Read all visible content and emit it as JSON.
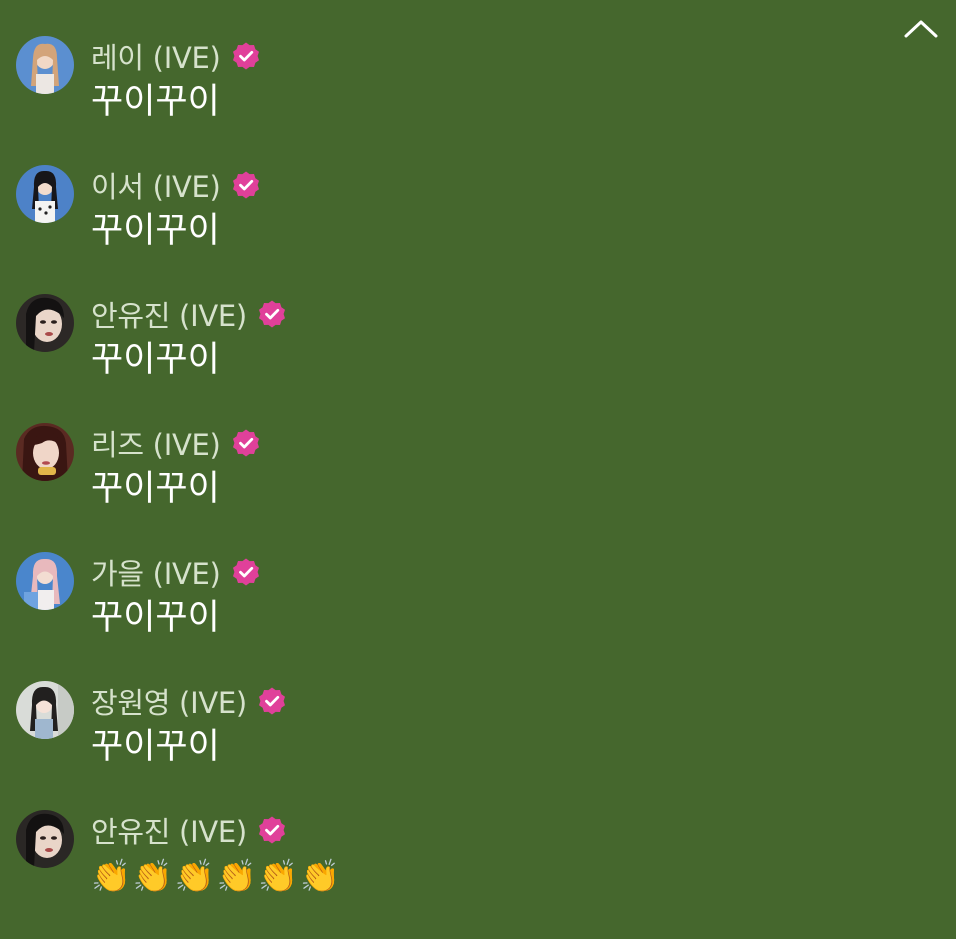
{
  "header": {
    "collapse_icon": "chevron-up-icon"
  },
  "badge": {
    "icon": "verified-badge-icon",
    "color": "#e0409a"
  },
  "messages": [
    {
      "author": "레이 (IVE)",
      "text": "꾸이꾸이",
      "avatar_bg": "#5b8fd0"
    },
    {
      "author": "이서 (IVE)",
      "text": "꾸이꾸이",
      "avatar_bg": "#4d82c8"
    },
    {
      "author": "안유진 (IVE)",
      "text": "꾸이꾸이",
      "avatar_bg": "#2c2826"
    },
    {
      "author": "리즈 (IVE)",
      "text": "꾸이꾸이",
      "avatar_bg": "#5a2a22"
    },
    {
      "author": "가을 (IVE)",
      "text": "꾸이꾸이",
      "avatar_bg": "#4a86cc"
    },
    {
      "author": "장원영 (IVE)",
      "text": "꾸이꾸이",
      "avatar_bg": "#d9dcd8"
    },
    {
      "author": "안유진 (IVE)",
      "text": "👏👏👏👏👏👏",
      "avatar_bg": "#2a2725"
    }
  ]
}
